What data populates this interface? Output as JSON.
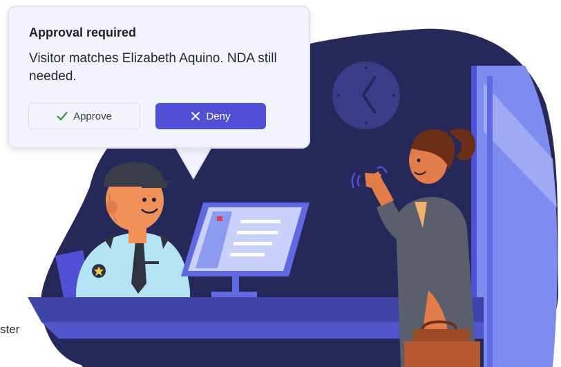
{
  "cutoff_label": "ster",
  "notification": {
    "title": "Approval required",
    "message": "Visitor matches Elizabeth Aquino. NDA still needed.",
    "approve_label": "Approve",
    "deny_label": "Deny"
  },
  "colors": {
    "scene_background": "#27285a",
    "desk": "#3f45a8",
    "approve_check": "#2f9a3a",
    "deny_button": "#4f50d6",
    "card_background": "#f3f4fb"
  },
  "icons": {
    "approve": "check-icon",
    "deny": "x-icon"
  }
}
